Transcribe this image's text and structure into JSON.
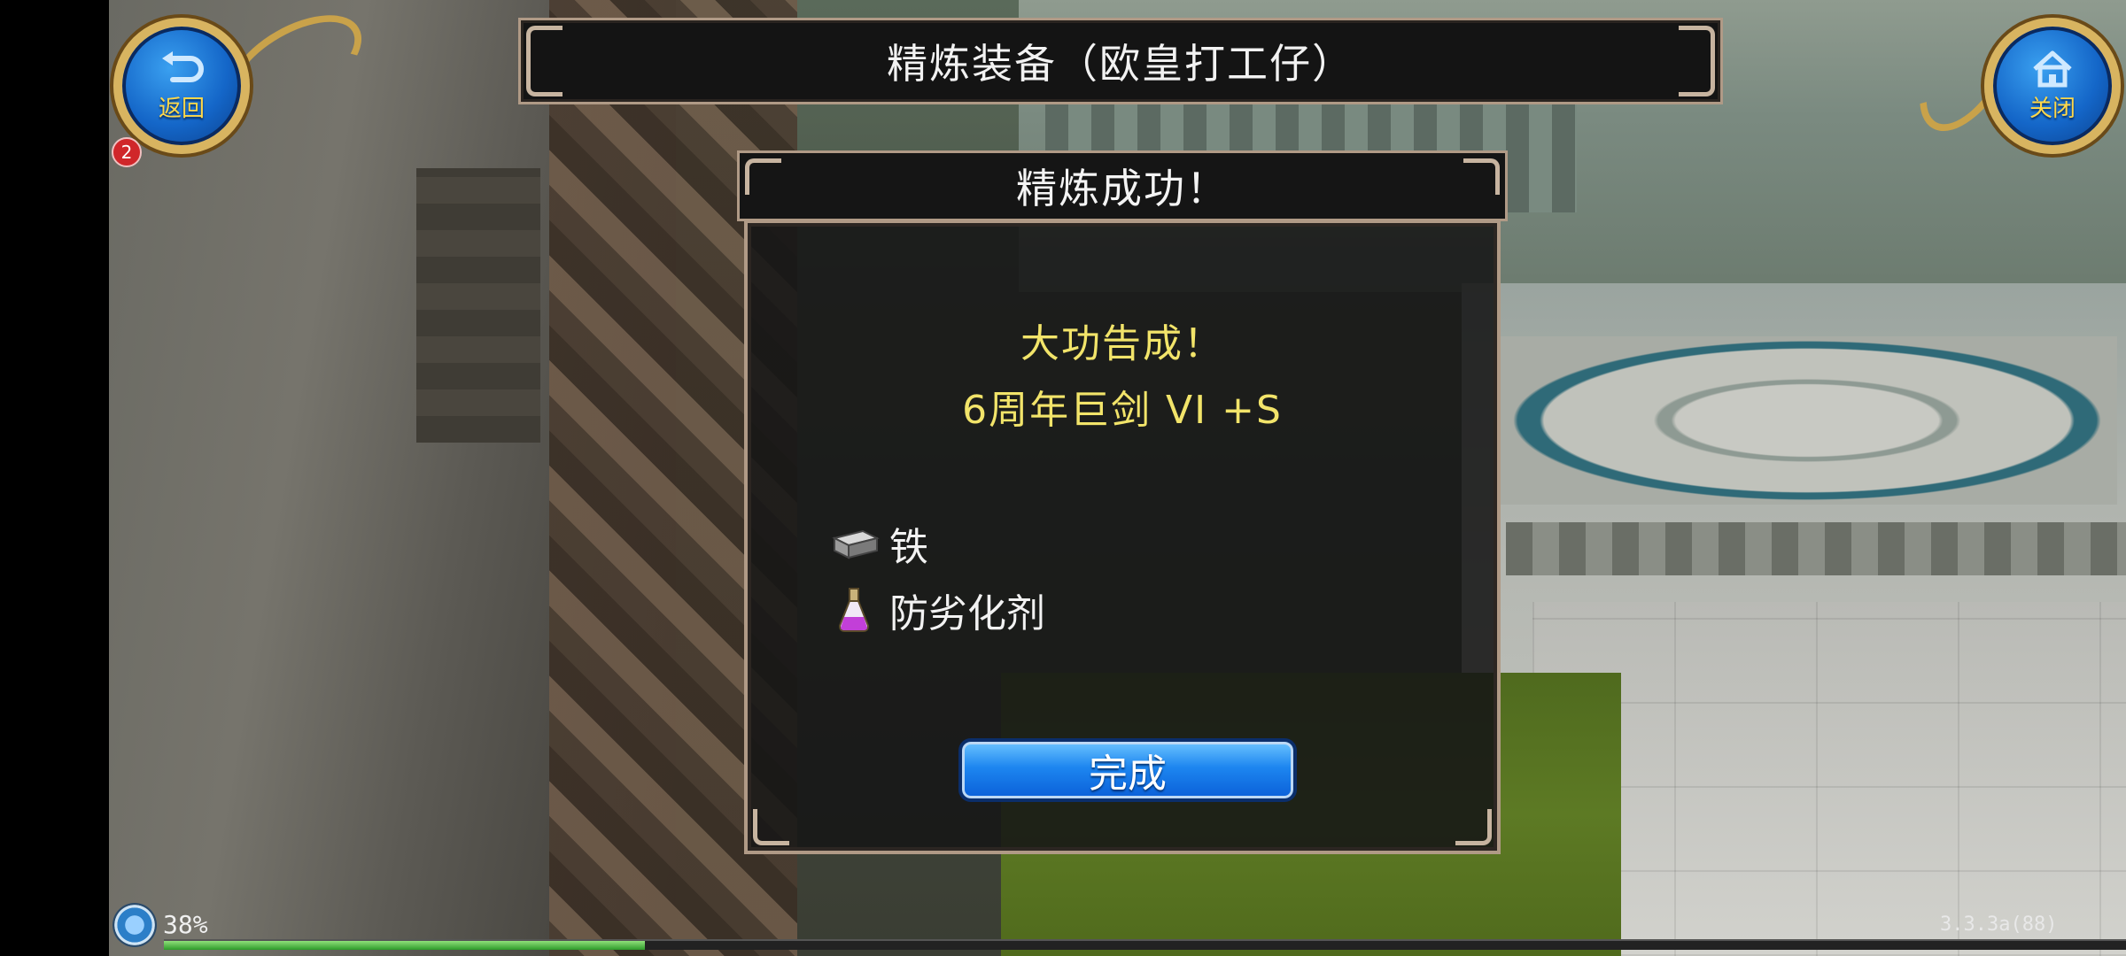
{
  "header": {
    "title": "精炼装备（欧皇打工仔）",
    "back_label": "返回",
    "close_label": "关闭",
    "notification_count": "2"
  },
  "dialog": {
    "title": "精炼成功！",
    "headline": "大功告成！",
    "item": "6周年巨剑 VI +S",
    "materials": [
      {
        "icon": "iron-ingot-icon",
        "label": "铁"
      },
      {
        "icon": "potion-flask-icon",
        "label": "防劣化剂"
      }
    ],
    "done_label": "完成"
  },
  "hud": {
    "exp_percent": "38%",
    "exp_fraction": 0.245,
    "version": "3.3.3a(88)"
  },
  "colors": {
    "headline": "#f2e46a",
    "button_blue": "#1d86f0",
    "frame": "#b09a86",
    "badge": "#d0262a"
  }
}
